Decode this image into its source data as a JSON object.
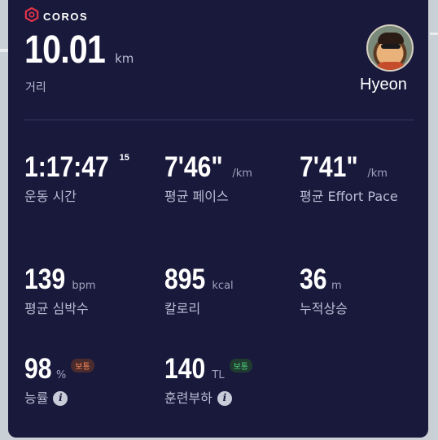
{
  "brand": {
    "name": "COROS"
  },
  "summary": {
    "distance_value": "10.01",
    "distance_unit": "km",
    "distance_label": "거리"
  },
  "user": {
    "name": "Hyeon"
  },
  "stats": [
    {
      "value": "1:17:47",
      "sup": "15",
      "unit": "",
      "label": "운동 시간"
    },
    {
      "value": "7'46\"",
      "unit": "/km",
      "label": "평균 페이스"
    },
    {
      "value": "7'41\"",
      "unit": "/km",
      "label": "평균 Effort Pace"
    },
    {
      "value": "139",
      "unit": "bpm",
      "label": "평균 심박수"
    },
    {
      "value": "895",
      "unit": "kcal",
      "label": "칼로리"
    },
    {
      "value": "36",
      "unit": "m",
      "label": "누적상승"
    },
    {
      "value": "98",
      "unit": "%",
      "badge": "보통",
      "label": "능률"
    },
    {
      "value": "140",
      "unit": "TL",
      "badge": "보통",
      "label": "훈련부하"
    }
  ],
  "colors": {
    "card_bg": "#19193c",
    "badge_orange": "#ff8a55",
    "badge_green": "#4fd07a",
    "brand_red": "#e8334a"
  },
  "icons": {
    "logo": "coros-hexagon-logo",
    "info": "info-icon"
  }
}
